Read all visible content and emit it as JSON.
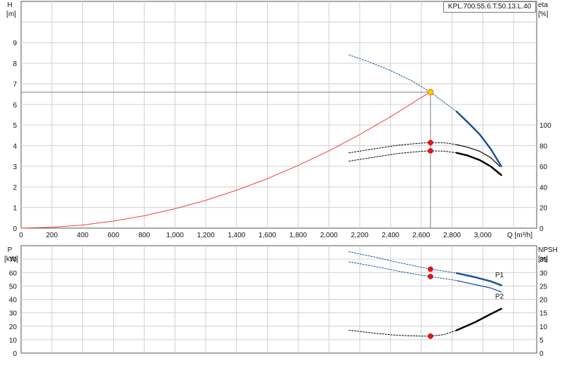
{
  "model_label": "KPL.700.55.6.T.50.13.L.40",
  "colors": {
    "grid": "#d0d0d0",
    "system_curve": "#f04040",
    "pump_curve_blue": "#1a5296",
    "efficiency_black": "#000000",
    "duty_point_fill": "#ffcc00",
    "marker_red": "#ee1111",
    "crosshair": "#808080"
  },
  "chart_data": [
    {
      "type": "line",
      "panel": "head-and-efficiency",
      "xlabel": "Q [m³/h]",
      "x_ticks": [
        "0",
        "200",
        "400",
        "600",
        "800",
        "1,000",
        "1,200",
        "1,400",
        "1,600",
        "1,800",
        "2,000",
        "2,200",
        "2,400",
        "2,600",
        "2,800",
        "3,000"
      ],
      "xlim": [
        0,
        3350
      ],
      "left_axis": {
        "label_line1": "H",
        "label_line2": "[m]",
        "ticks": [
          "0",
          "1",
          "2",
          "3",
          "4",
          "5",
          "6",
          "7",
          "8",
          "9"
        ],
        "ylim": [
          0,
          11
        ]
      },
      "right_axis": {
        "label_line1": "eta",
        "label_line2": "[%]",
        "ticks": [
          "0",
          "20",
          "40",
          "60",
          "80",
          "100"
        ],
        "ylim": [
          0,
          220
        ]
      },
      "grid": true,
      "duty_point": {
        "q": 2660,
        "h": 6.6
      },
      "series": [
        {
          "role": "system-curve",
          "axis": "left",
          "style": "solid-red",
          "x": [
            0,
            200,
            400,
            600,
            800,
            1000,
            1200,
            1400,
            1600,
            1800,
            2000,
            2200,
            2400,
            2600,
            2660
          ],
          "y": [
            0,
            0.04,
            0.15,
            0.34,
            0.6,
            0.94,
            1.35,
            1.84,
            2.4,
            3.04,
            3.75,
            4.54,
            5.4,
            6.34,
            6.6
          ]
        },
        {
          "role": "pump-curve-extended",
          "axis": "left",
          "style": "dotted-blue",
          "x": [
            2130,
            2250,
            2400,
            2550,
            2660,
            2750,
            2830
          ],
          "y": [
            8.4,
            8.1,
            7.65,
            7.1,
            6.6,
            6.1,
            5.65
          ]
        },
        {
          "role": "pump-curve-operating",
          "axis": "left",
          "style": "solid-blue",
          "x": [
            2830,
            2900,
            2980,
            3050,
            3120
          ],
          "y": [
            5.65,
            5.15,
            4.55,
            3.85,
            3.0
          ]
        },
        {
          "role": "efficiency-upper-extended",
          "axis": "right",
          "style": "dotted-black",
          "x": [
            2130,
            2300,
            2450,
            2600,
            2660,
            2750,
            2830
          ],
          "y": [
            73,
            77,
            80.5,
            82.5,
            83,
            82.8,
            81
          ]
        },
        {
          "role": "efficiency-upper-operating",
          "axis": "right",
          "style": "solid-black-thin",
          "x": [
            2830,
            2900,
            2980,
            3050,
            3110
          ],
          "y": [
            81,
            78.5,
            74.5,
            68.5,
            60
          ]
        },
        {
          "role": "efficiency-lower-extended",
          "axis": "right",
          "style": "dotted-black",
          "x": [
            2130,
            2300,
            2450,
            2600,
            2660,
            2750,
            2830
          ],
          "y": [
            65,
            69,
            72.5,
            74.5,
            75,
            74.7,
            73
          ]
        },
        {
          "role": "efficiency-lower-operating",
          "axis": "right",
          "style": "solid-black-thick",
          "x": [
            2830,
            2900,
            2980,
            3050,
            3120
          ],
          "y": [
            73,
            70.5,
            66,
            60,
            51.5
          ]
        }
      ],
      "markers": [
        {
          "role": "efficiency-upper-point",
          "axis": "right",
          "q": 2660,
          "v": 83
        },
        {
          "role": "efficiency-lower-point",
          "axis": "right",
          "q": 2660,
          "v": 75
        }
      ]
    },
    {
      "type": "line",
      "panel": "power-and-npsh",
      "xlim": [
        0,
        3350
      ],
      "left_axis": {
        "label_line1": "P",
        "label_line2": "[kW]",
        "ticks": [
          "0",
          "10",
          "20",
          "30",
          "40",
          "50",
          "60",
          "70"
        ],
        "ylim": [
          0,
          80
        ]
      },
      "right_axis": {
        "label_line1": "NPSH",
        "label_line2": "[m]",
        "ticks": [
          "0",
          "5",
          "10",
          "15",
          "20",
          "25",
          "30",
          "35"
        ],
        "ylim": [
          0,
          40
        ]
      },
      "grid": true,
      "series": [
        {
          "name": "P1",
          "axis": "left",
          "style": "dotted-blue",
          "x": [
            2130,
            2300,
            2450,
            2600,
            2660,
            2750,
            2830
          ],
          "y": [
            75.5,
            71.5,
            67.5,
            64,
            62.5,
            61,
            59.5
          ]
        },
        {
          "name": "P1",
          "axis": "left",
          "style": "solid-blue",
          "x": [
            2830,
            2950,
            3050,
            3120
          ],
          "y": [
            59.5,
            56.5,
            53.5,
            50.5
          ]
        },
        {
          "name": "P2",
          "axis": "left",
          "style": "dotted-blue",
          "x": [
            2130,
            2300,
            2450,
            2600,
            2660,
            2750,
            2830
          ],
          "y": [
            68,
            64.5,
            61,
            58,
            57,
            55.5,
            54
          ]
        },
        {
          "name": "P2",
          "axis": "left",
          "style": "solid-blue-thin",
          "x": [
            2830,
            2950,
            3050,
            3120
          ],
          "y": [
            54,
            51,
            48.5,
            45.5
          ]
        },
        {
          "role": "npsh-extended",
          "axis": "right",
          "style": "dotted-black",
          "x": [
            2130,
            2300,
            2450,
            2600,
            2660,
            2750,
            2830
          ],
          "y": [
            8.5,
            7.4,
            6.6,
            6.3,
            6.3,
            6.9,
            8.5
          ]
        },
        {
          "role": "npsh-operating",
          "axis": "right",
          "style": "solid-black-thick",
          "x": [
            2830,
            2950,
            3050,
            3120
          ],
          "y": [
            8.5,
            11.5,
            14.5,
            16.5
          ]
        }
      ],
      "series_labels": [
        {
          "text": "P1",
          "q": 3080,
          "v": 58.5
        },
        {
          "text": "P2",
          "q": 3080,
          "v": 42.5
        }
      ],
      "markers": [
        {
          "role": "p1-point",
          "axis": "left",
          "q": 2660,
          "v": 62.5
        },
        {
          "role": "p2-point",
          "axis": "left",
          "q": 2660,
          "v": 57
        },
        {
          "role": "npsh-point",
          "axis": "right",
          "q": 2660,
          "v": 6.3
        }
      ]
    }
  ]
}
